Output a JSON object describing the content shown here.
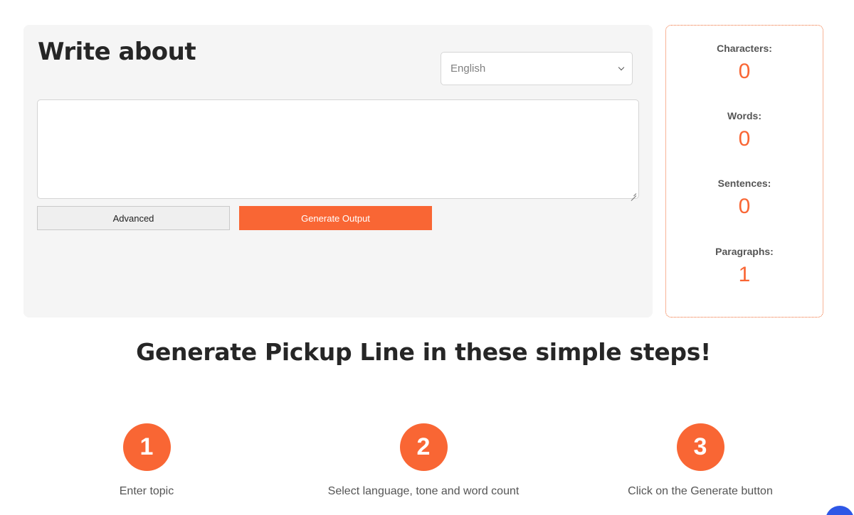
{
  "editor": {
    "title": "Write about",
    "language": {
      "selected": "English"
    },
    "topic_input": {
      "value": ""
    },
    "advanced_label": "Advanced",
    "generate_label": "Generate Output"
  },
  "stats": {
    "characters": {
      "label": "Characters:",
      "value": "0"
    },
    "words": {
      "label": "Words:",
      "value": "0"
    },
    "sentences": {
      "label": "Sentences:",
      "value": "0"
    },
    "paragraphs": {
      "label": "Paragraphs:",
      "value": "1"
    }
  },
  "steps": {
    "heading": "Generate Pickup Line in these simple steps!",
    "items": [
      {
        "number": "1",
        "text": "Enter topic"
      },
      {
        "number": "2",
        "text": "Select language, tone and word count"
      },
      {
        "number": "3",
        "text": "Click on the Generate button"
      }
    ]
  },
  "colors": {
    "accent": "#f96634",
    "panel_bg": "#f5f5f5",
    "chat_bubble": "#2e57e6"
  }
}
